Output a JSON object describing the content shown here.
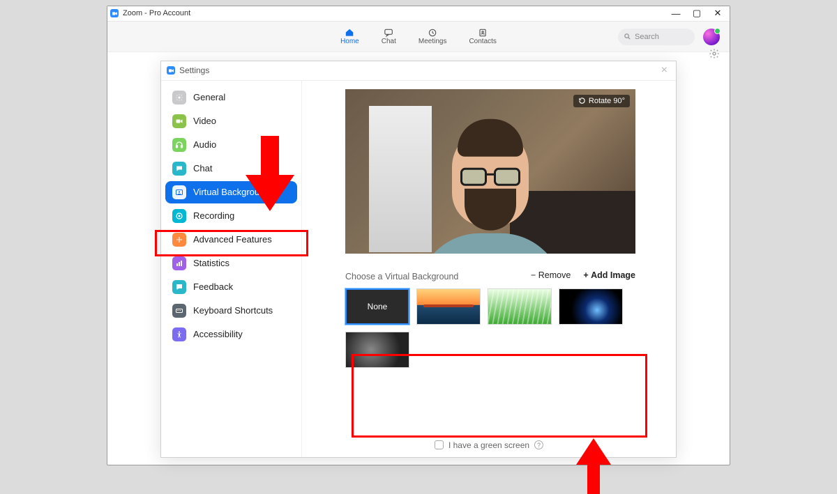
{
  "window": {
    "title": "Zoom - Pro Account",
    "controls": {
      "minimize": "—",
      "maximize": "▢",
      "close": "✕"
    }
  },
  "nav": {
    "home": "Home",
    "chat": "Chat",
    "meetings": "Meetings",
    "contacts": "Contacts",
    "active": "home"
  },
  "search": {
    "placeholder": "Search"
  },
  "settings": {
    "title": "Settings",
    "items": [
      {
        "label": "General"
      },
      {
        "label": "Video"
      },
      {
        "label": "Audio"
      },
      {
        "label": "Chat"
      },
      {
        "label": "Virtual Background"
      },
      {
        "label": "Recording"
      },
      {
        "label": "Advanced Features"
      },
      {
        "label": "Statistics"
      },
      {
        "label": "Feedback"
      },
      {
        "label": "Keyboard Shortcuts"
      },
      {
        "label": "Accessibility"
      }
    ],
    "active_index": 4
  },
  "vb": {
    "rotate_label": "Rotate 90°",
    "choose_label": "Choose a Virtual Background",
    "remove_label": "Remove",
    "add_label": "Add Image",
    "none_label": "None",
    "green_screen_label": "I have a green screen"
  }
}
